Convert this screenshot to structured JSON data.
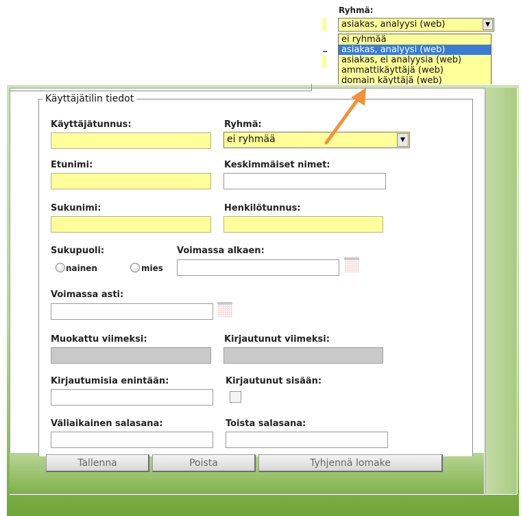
{
  "top_popup": {
    "label": "Ryhmä:",
    "selected": "asiakas, analyysi (web)",
    "options": [
      {
        "label": "ei ryhmää",
        "selected": false
      },
      {
        "label": "asiakas, analyysi (web)",
        "selected": true
      },
      {
        "label": "asiakas, ei analyysia (web)",
        "selected": false
      },
      {
        "label": "ammattikäyttäjä (web)",
        "selected": false
      },
      {
        "label": "domain käyttäjä (web)",
        "selected": false
      }
    ]
  },
  "form": {
    "legend": "Käyttäjätilin tiedot",
    "username_label": "Käyttäjätunnus:",
    "group_label": "Ryhmä:",
    "group_value": "ei ryhmää",
    "firstname_label": "Etunimi:",
    "middlenames_label": "Keskimmäiset nimet:",
    "lastname_label": "Sukunimi:",
    "ssn_label": "Henkilötunnus:",
    "gender_label": "Sukupuoli:",
    "gender_female": "nainen",
    "gender_male": "mies",
    "valid_from_label": "Voimassa alkaen:",
    "valid_to_label": "Voimassa asti:",
    "modified_label": "Muokattu viimeksi:",
    "last_login_label": "Kirjautunut viimeksi:",
    "max_logins_label": "Kirjautumisia enintään:",
    "logged_in_label": "Kirjautunut sisään:",
    "temp_password_label": "Väliaikainen salasana:",
    "repeat_password_label": "Toista salasana:"
  },
  "buttons": {
    "save": "Tallenna",
    "delete": "Poista",
    "clear": "Tyhjennä lomake"
  },
  "colors": {
    "required_field": "#ffff99",
    "readonly_field": "#c9c9c9",
    "frame_green": "#8fbd5b",
    "highlight_blue": "#3b7bd4",
    "arrow_orange": "#f0923a"
  }
}
